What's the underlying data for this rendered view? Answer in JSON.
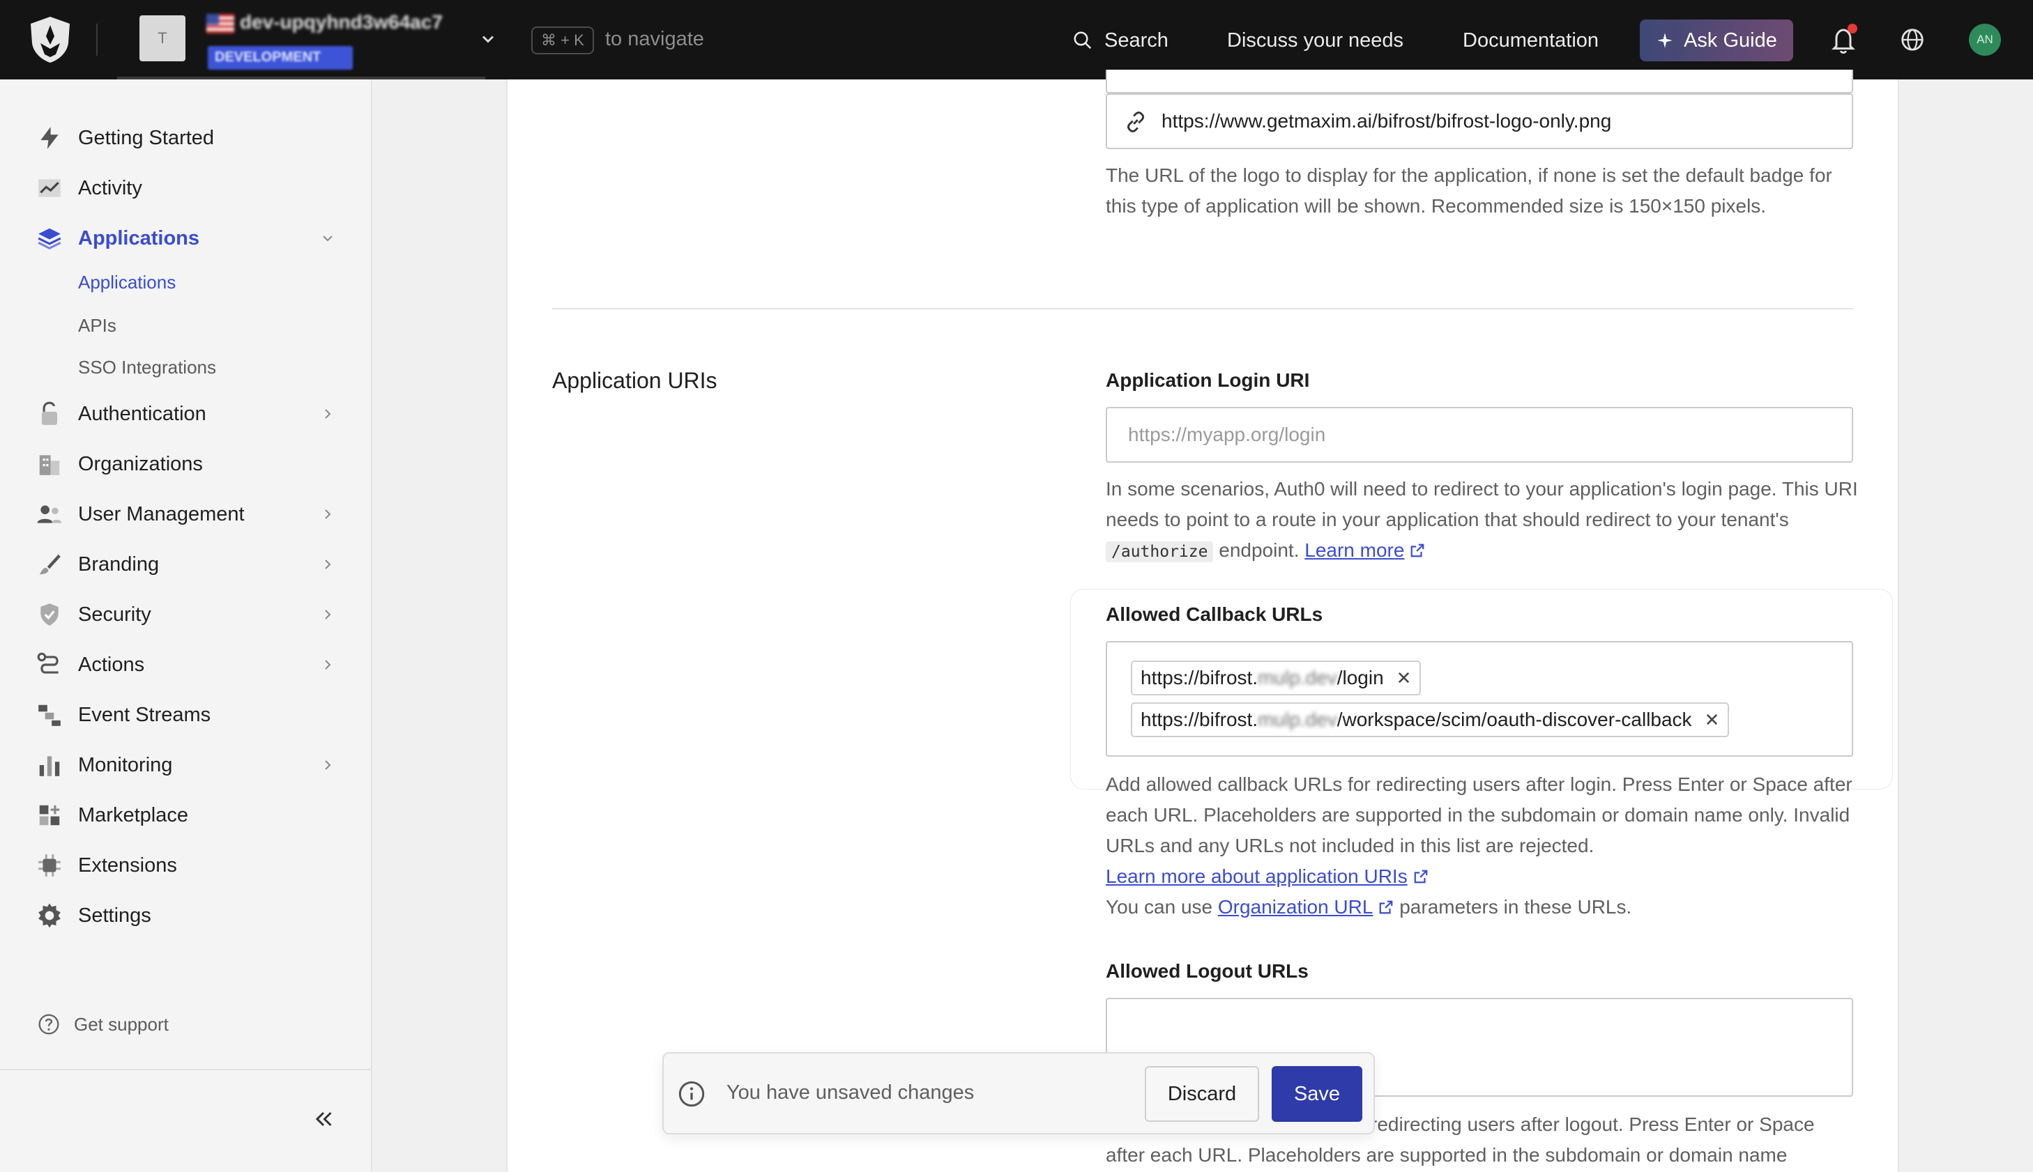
{
  "topbar": {
    "tenant_initial": "T",
    "tenant_name": "dev-upqyhnd3w64ac7",
    "tenant_environment": "DEVELOPMENT",
    "shortcut_key": "⌘ + K",
    "shortcut_label": "to navigate",
    "search_label": "Search",
    "discuss_label": "Discuss your needs",
    "documentation_label": "Documentation",
    "ask_guide_label": "Ask Guide",
    "user_initials": "AN",
    "accent_color": "#3a4cd0"
  },
  "sidebar": {
    "items": [
      {
        "label": "Getting Started",
        "icon": "bolt-icon"
      },
      {
        "label": "Activity",
        "icon": "activity-chart-icon"
      },
      {
        "label": "Applications",
        "icon": "layers-icon"
      },
      {
        "label": "Authentication",
        "icon": "lock-icon"
      },
      {
        "label": "Organizations",
        "icon": "building-icon"
      },
      {
        "label": "User Management",
        "icon": "users-icon"
      },
      {
        "label": "Branding",
        "icon": "brush-icon"
      },
      {
        "label": "Security",
        "icon": "shield-check-icon"
      },
      {
        "label": "Actions",
        "icon": "flow-icon"
      },
      {
        "label": "Event Streams",
        "icon": "stream-icon"
      },
      {
        "label": "Monitoring",
        "icon": "bar-chart-icon"
      },
      {
        "label": "Marketplace",
        "icon": "grid-plus-icon"
      },
      {
        "label": "Extensions",
        "icon": "chip-icon"
      },
      {
        "label": "Settings",
        "icon": "gear-icon"
      }
    ],
    "applications_sub": [
      "Applications",
      "APIs",
      "SSO Integrations"
    ],
    "support_label": "Get support"
  },
  "main": {
    "logo_url_value": "https://www.getmaxim.ai/bifrost/bifrost-logo-only.png",
    "logo_help": "The URL of the logo to display for the application, if none is set the default badge for this type of application will be shown. Recommended size is 150×150 pixels.",
    "section_title": "Application URIs",
    "login_uri_label": "Application Login URI",
    "login_uri_placeholder": "https://myapp.org/login",
    "login_help_1": "In some scenarios, Auth0 will need to redirect to your application's login page. This URI needs to point to a route in your application that should redirect to your tenant's",
    "login_help_code": "/authorize",
    "login_help_2": "endpoint.",
    "learn_more": "Learn more",
    "callback_label": "Allowed Callback URLs",
    "callback_chips": [
      {
        "prefix": "https://bifrost.",
        "blurred": "mulp.dev",
        "suffix": "/login"
      },
      {
        "prefix": "https://bifrost.",
        "blurred": "mulp.dev",
        "suffix": "/workspace/scim/oauth-discover-callback"
      }
    ],
    "callback_help": "Add allowed callback URLs for redirecting users after login. Press Enter or Space after each URL. Placeholders are supported in the subdomain or domain name only. Invalid URLs and any URLs not included in this list are rejected.",
    "learn_more_uris": "Learn more about application URIs",
    "org_url_prefix": "You can use",
    "org_url_link": "Organization URL",
    "org_url_suffix": "parameters in these URLs.",
    "logout_label": "Allowed Logout URLs",
    "logout_help_line1": "redirecting users after logout. Press Enter or Space",
    "logout_help_line2": "after each URL. Placeholders are supported in the subdomain or domain name"
  },
  "unsaved_bar": {
    "message": "You have unsaved changes",
    "discard_label": "Discard",
    "save_label": "Save"
  }
}
